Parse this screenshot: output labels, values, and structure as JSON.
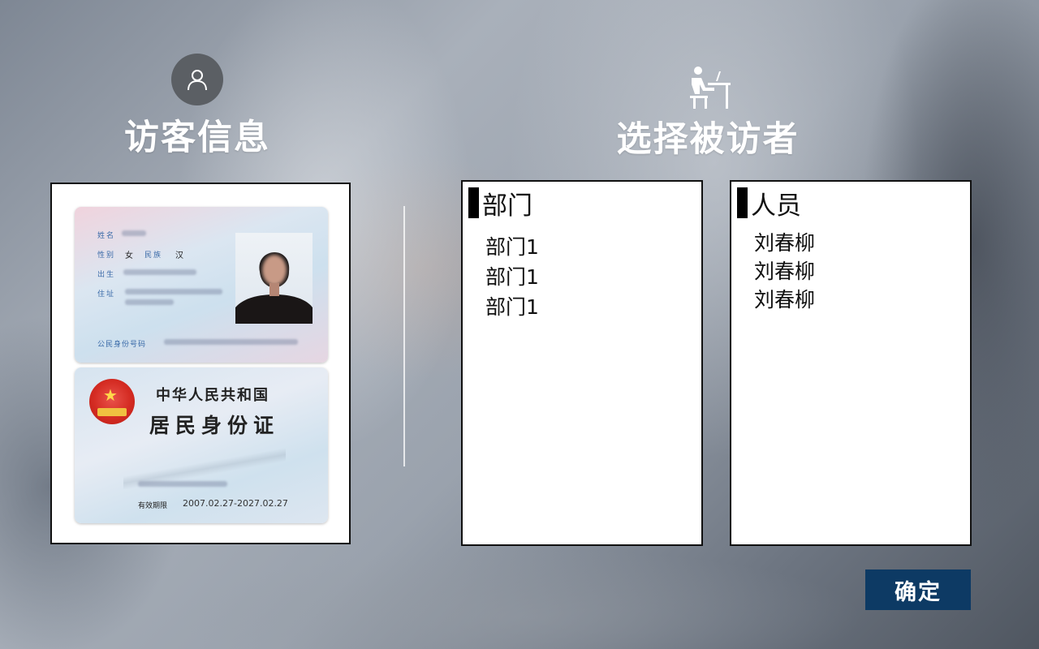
{
  "visitor_info": {
    "title": "访客信息",
    "icon": "user-icon"
  },
  "host_select": {
    "title": "选择被访者",
    "icon": "person-at-desk-icon"
  },
  "id_card": {
    "front": {
      "name_label": "姓名",
      "gender_label": "性别",
      "gender_value": "女",
      "ethnicity_label": "民族",
      "ethnicity_value": "汉",
      "birth_label": "出生",
      "address_label": "住址",
      "id_number_label": "公民身份号码"
    },
    "back": {
      "country": "中华人民共和国",
      "card_name": "居民身份证",
      "validity_label": "有效期限",
      "validity_value": "2007.02.27-2027.02.27"
    }
  },
  "departments": {
    "header": "部门",
    "items": [
      "部门1",
      "部门1",
      "部门1"
    ]
  },
  "people": {
    "header": "人员",
    "items": [
      "刘春柳",
      "刘春柳",
      "刘春柳"
    ]
  },
  "confirm_label": "确定",
  "colors": {
    "confirm_bg": "#0d3a64",
    "avatar_bg": "#5b5f64"
  }
}
